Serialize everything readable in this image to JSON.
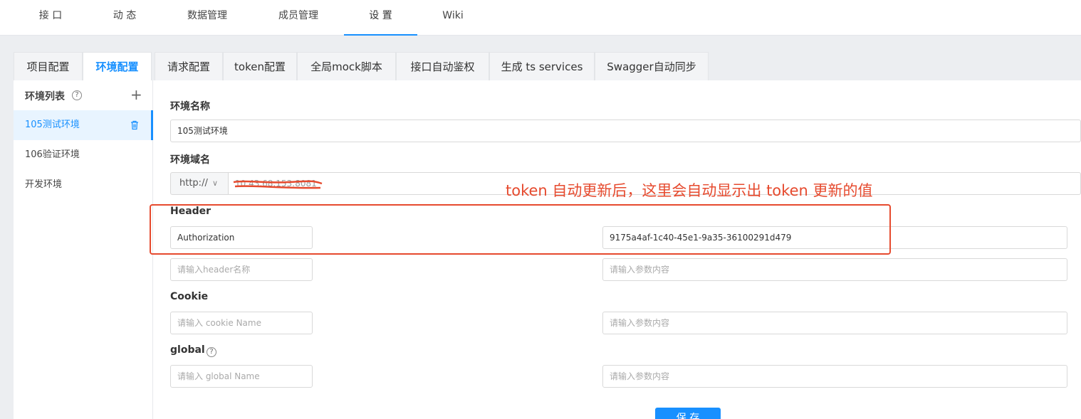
{
  "topnav": {
    "items": [
      "接 口",
      "动 态",
      "数据管理",
      "成员管理",
      "设 置",
      "Wiki"
    ],
    "active": "设 置"
  },
  "subtabs": {
    "items": [
      "项目配置",
      "环境配置",
      "请求配置",
      "token配置",
      "全局mock脚本",
      "接口自动鉴权",
      "生成 ts services",
      "Swagger自动同步"
    ],
    "active": "环境配置"
  },
  "sidebar": {
    "title": "环境列表",
    "help_icon": "?",
    "add_icon": "+",
    "envs": [
      {
        "label": "105测试环境",
        "active": true
      },
      {
        "label": "106验证环境",
        "active": false
      },
      {
        "label": "开发环境",
        "active": false
      }
    ]
  },
  "form": {
    "env_name_label": "环境名称",
    "env_name_value": "105测试环境",
    "domain_label": "环境域名",
    "protocol": "http://",
    "protocol_chevron": "∨",
    "domain_value": "10.43.68.153:8081",
    "header_label": "Header",
    "header_rows": [
      {
        "name": "Authorization",
        "value": "9175a4af-1c40-45e1-9a35-36100291d479"
      },
      {
        "name_placeholder": "请输入header名称",
        "value_placeholder": "请输入参数内容"
      }
    ],
    "cookie_label": "Cookie",
    "cookie_name_placeholder": "请输入 cookie Name",
    "cookie_value_placeholder": "请输入参数内容",
    "global_label": "global",
    "global_name_placeholder": "请输入 global Name",
    "global_value_placeholder": "请输入参数内容",
    "save_label": "保 存"
  },
  "annotation": {
    "text": "token 自动更新后，这里会自动显示出 token 更新的值",
    "color": "#e64a2e"
  },
  "colors": {
    "accent": "#1890ff"
  }
}
